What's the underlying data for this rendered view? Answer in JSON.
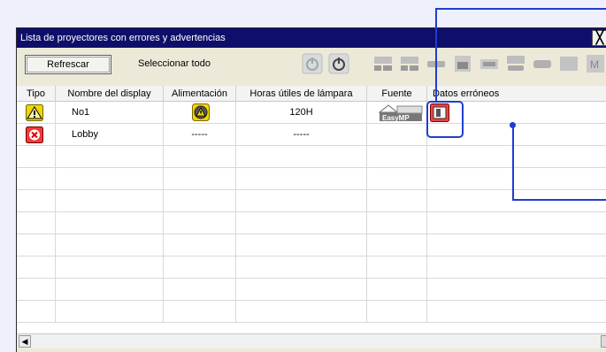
{
  "window": {
    "title": "Lista de proyectores con errores y advertencias"
  },
  "toolbar": {
    "refresh_label": "Refrescar",
    "select_all_label": "Seleccionar todo",
    "icons": [
      "power-on-icon",
      "power-off-icon",
      "computer1-icon",
      "computer2-icon",
      "video-icon",
      "s-video-icon",
      "component-icon",
      "hdmi-icon",
      "dvi-icon",
      "pc-free-icon",
      "more-icon"
    ]
  },
  "table": {
    "headers": [
      "Tipo",
      "Nombre del display",
      "Alimentación",
      "Horas útiles de lámpara",
      "Fuente",
      "Datos erróneos"
    ],
    "rows": [
      {
        "type_icon": "warning-icon",
        "name": "No1",
        "power_icon": "power-warning-icon",
        "lamp_hours": "120H",
        "source_icon": "easymp-icon",
        "error_icon": "projector-error-icon"
      },
      {
        "type_icon": "error-icon",
        "name": "Lobby",
        "power_text": "-----",
        "lamp_hours": "-----"
      }
    ]
  },
  "colors": {
    "accent": "#1f3ecf",
    "titlebar": "#0f0f6b"
  }
}
